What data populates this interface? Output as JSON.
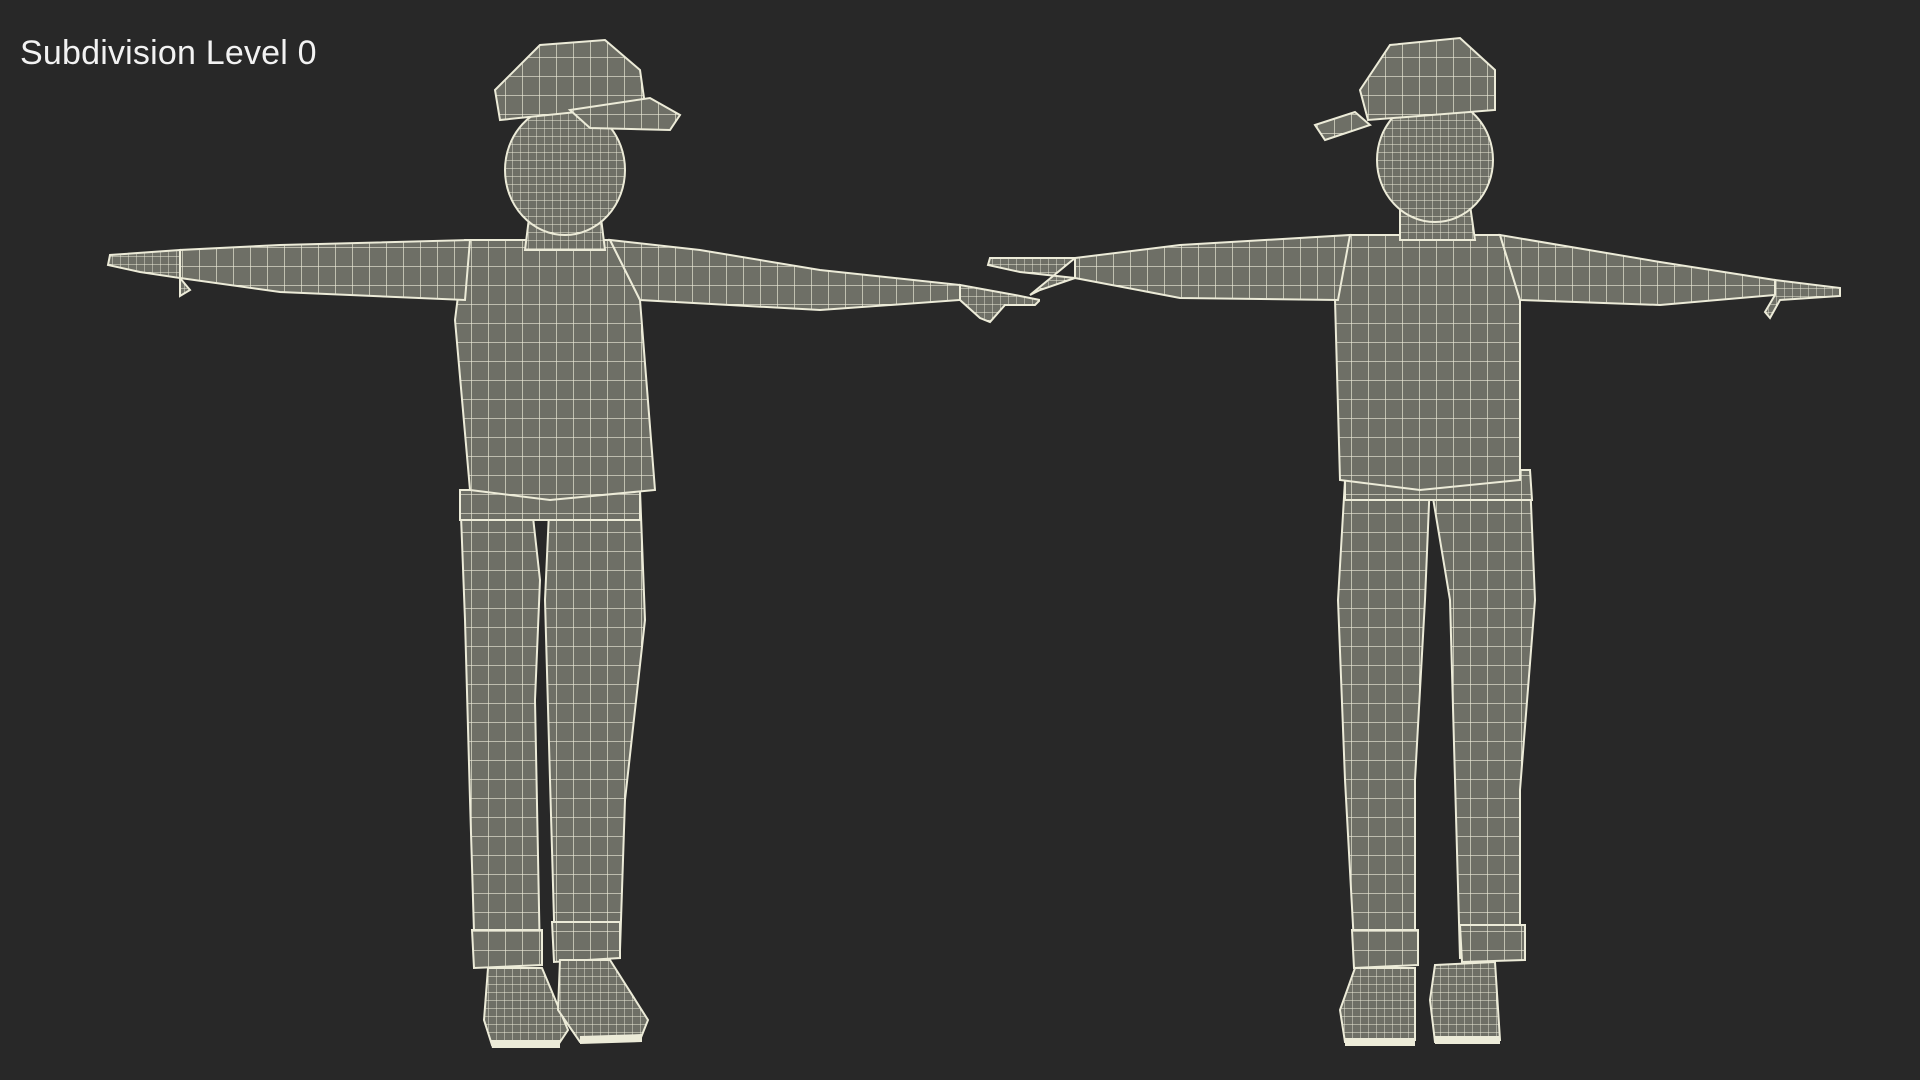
{
  "viewport": {
    "label": "Subdivision Level 0",
    "background_color": "#282828",
    "label_color": "#f2f2f2"
  },
  "model": {
    "surface_color": "#6e6f66",
    "wire_color": "#ecebd8",
    "views": [
      "front-three-quarter",
      "back-three-quarter"
    ]
  }
}
